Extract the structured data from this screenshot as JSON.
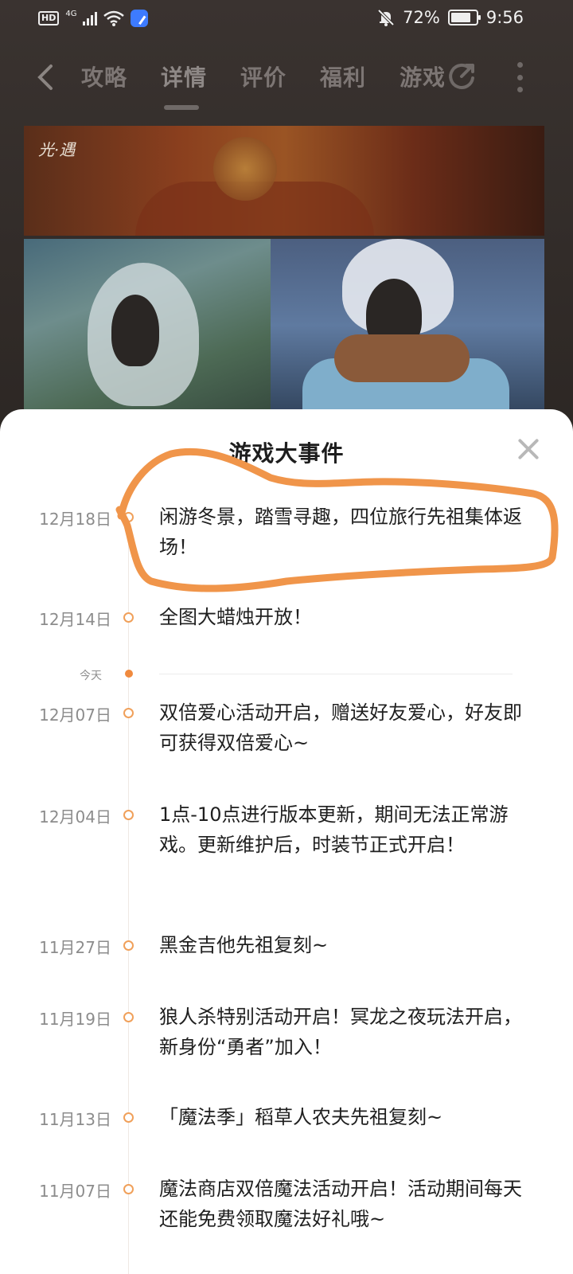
{
  "status_bar": {
    "hd": "HD",
    "network": "4G",
    "battery_percent": "72%",
    "time": "9:56"
  },
  "nav": {
    "tabs": [
      {
        "label": "攻略",
        "active": false
      },
      {
        "label": "详情",
        "active": true
      },
      {
        "label": "评价",
        "active": false
      },
      {
        "label": "福利",
        "active": false
      },
      {
        "label": "游戏",
        "active": false
      }
    ],
    "back_icon": "chevron-left-icon",
    "share_icon": "share-icon",
    "more_icon": "more-vertical-icon"
  },
  "gallery": {
    "logo_text": "光·遇"
  },
  "sheet": {
    "title": "游戏大事件",
    "close_icon": "close-icon",
    "today_label": "今天",
    "events_upcoming": [
      {
        "date": "12月18日",
        "text": "闲游冬景，踏雪寻趣，四位旅行先祖集体返场！"
      },
      {
        "date": "12月14日",
        "text": "全图大蜡烛开放！"
      }
    ],
    "events_past": [
      {
        "date": "12月07日",
        "text": "双倍爱心活动开启，赠送好友爱心，好友即可获得双倍爱心~"
      },
      {
        "date": "12月04日",
        "text": "1点-10点进行版本更新，期间无法正常游戏。更新维护后，时装节正式开启！"
      },
      {
        "date": "11月27日",
        "text": "黑金吉他先祖复刻~"
      },
      {
        "date": "11月19日",
        "text": "狼人杀特别活动开启！冥龙之夜玩法开启，新身份“勇者”加入！"
      },
      {
        "date": "11月13日",
        "text": "「魔法季」稻草人农夫先祖复刻~"
      },
      {
        "date": "11月07日",
        "text": "魔法商店双倍魔法活动开启！活动期间每天还能免费领取魔法好礼哦~"
      }
    ]
  },
  "colors": {
    "accent_orange": "#f08a3e",
    "annotation_orange": "#f0954a",
    "sheet_background": "#ffffff",
    "backdrop": "#2a2522"
  }
}
